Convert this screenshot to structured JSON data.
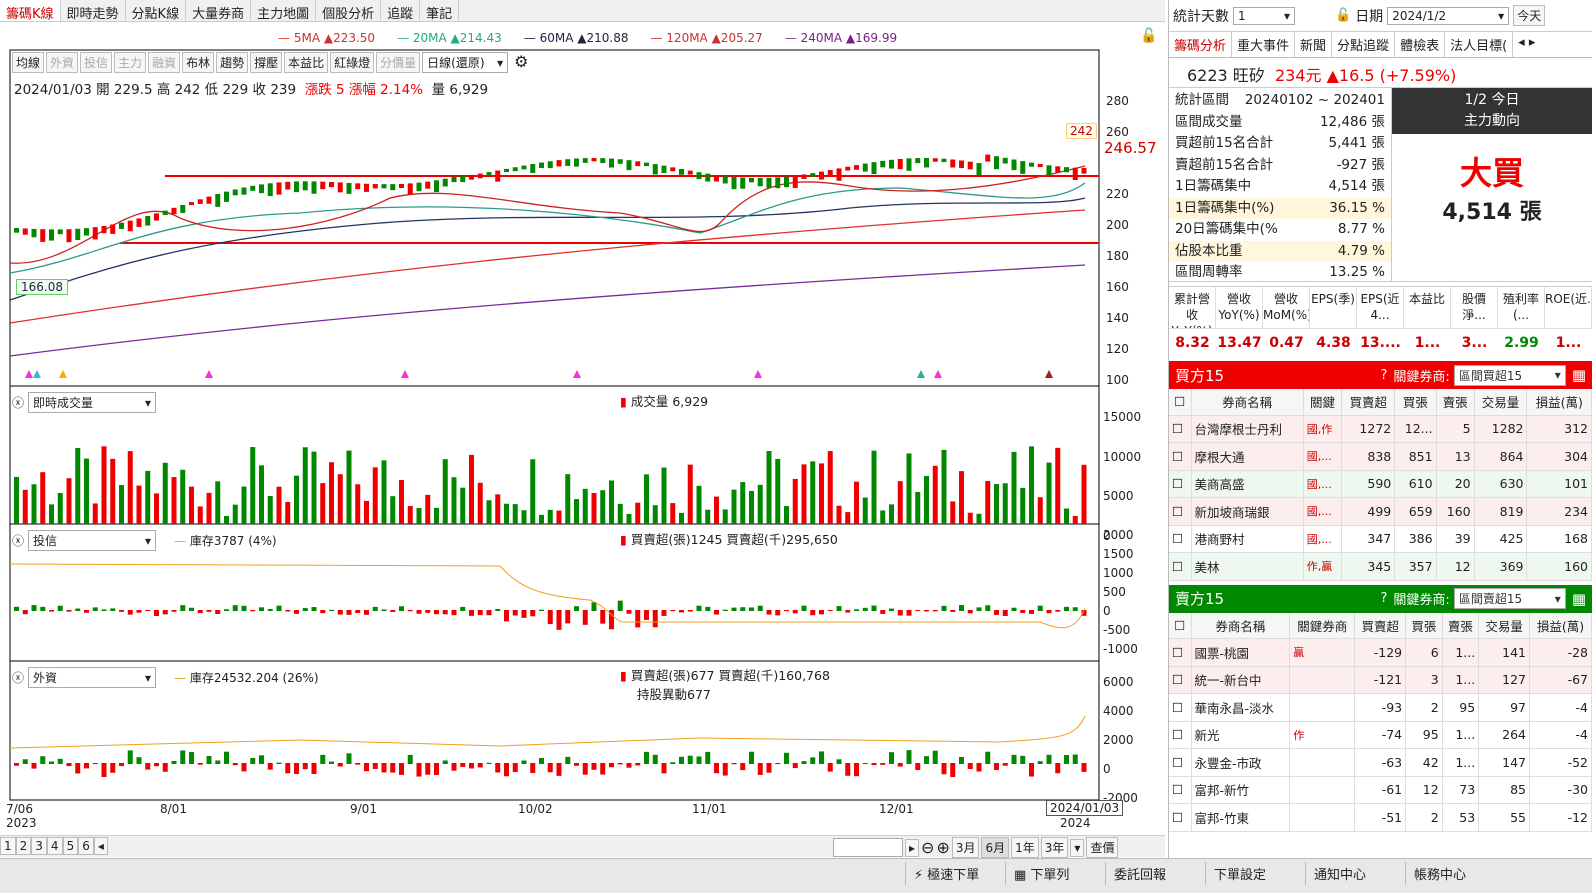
{
  "tabs": [
    "籌碼K線",
    "即時走勢",
    "分點K線",
    "大量券商",
    "主力地圖",
    "個股分析",
    "追蹤",
    "筆記"
  ],
  "ma": {
    "ma5": "5MA ▲223.50",
    "ma20": "20MA ▲214.43",
    "ma60": "60MA ▲210.88",
    "ma120": "120MA ▲205.27",
    "ma240": "240MA ▲169.99"
  },
  "toolbar": [
    "均線",
    "外資",
    "投信",
    "主力",
    "融資",
    "布林",
    "趨勢",
    "撐壓",
    "本益比",
    "紅綠燈",
    "分價量"
  ],
  "period": "日線(還原)",
  "ohlc": "2024/01/03 開 229.5 高 242 低 229 收 239",
  "change": "漲跌 5  漲幅 2.14%",
  "volume_label": "量 6,929",
  "price_axis": [
    "280",
    "260",
    "240",
    "220",
    "200",
    "180",
    "160",
    "140",
    "120",
    "100"
  ],
  "last_price": "246.57",
  "high_mark": "242",
  "low_mark": "166.08",
  "vol_panel": {
    "select": "即時成交量",
    "legend": "成交量  6,929",
    "axis": [
      "15000",
      "10000",
      "5000",
      "0"
    ]
  },
  "trust_panel": {
    "select": "投信",
    "inv": "庫存3787 (4%)",
    "legend": "買賣超(張)1245 買賣超(千)295,650",
    "axis": [
      "2000",
      "1500",
      "1000",
      "500",
      "0",
      "-500",
      "-1000"
    ]
  },
  "foreign_panel": {
    "select": "外資",
    "inv": "庫存24532.204 (26%)",
    "legend": "買賣超(張)677 買賣超(千)160,768",
    "legend2": "持股異動677",
    "axis": [
      "6000",
      "4000",
      "2000",
      "0",
      "-2000"
    ]
  },
  "xaxis": {
    "d0": "7/06",
    "y0": "2023",
    "d1": "8/01",
    "d2": "9/01",
    "d3": "10/02",
    "d4": "11/01",
    "d5": "12/01",
    "d6": "2024/01/03",
    "y1": "2024"
  },
  "bottom_pages": [
    "1",
    "2",
    "3",
    "4",
    "5",
    "6"
  ],
  "ranges": [
    "3月",
    "6月",
    "1年",
    "3年",
    "查價"
  ],
  "right": {
    "stat_days_label": "統計天數",
    "stat_days": "1",
    "date_label": "日期",
    "date": "2024/1/2",
    "today": "今天",
    "tabs": [
      "籌碼分析",
      "重大事件",
      "新聞",
      "分點追蹤",
      "體檢表",
      "法人目標("
    ],
    "stock": "6223 旺矽",
    "price": "234元",
    "chg": "▲16.5 (+7.59%)",
    "kv": [
      [
        "統計區間",
        "20240102 ~ 202401"
      ],
      [
        "區間成交量",
        "12,486 張"
      ],
      [
        "買超前15名合計",
        "5,441 張"
      ],
      [
        "賣超前15名合計",
        "-927 張"
      ],
      [
        "1日籌碼集中",
        "4,514 張"
      ],
      [
        "1日籌碼集中(%)",
        "36.15 %"
      ],
      [
        "20日籌碼集中(%",
        "8.77 %"
      ],
      [
        "佔股本比重",
        "4.79 %"
      ],
      [
        "區間周轉率",
        "13.25 %"
      ]
    ],
    "box_title1": "1/2 今日",
    "box_title2": "主力動向",
    "box_main": "大買",
    "box_sub": "4,514 張",
    "fin_heads": [
      "累計營收YoY(%)",
      "營收YoY(%)",
      "營收MoM(%)",
      "EPS(季)",
      "EPS(近4...",
      "本益比",
      "股價淨...",
      "殖利率(...",
      "ROE(近..."
    ],
    "fin_vals": [
      "8.32",
      "13.47",
      "0.47",
      "4.38",
      "13....",
      "1...",
      "3...",
      "2.99",
      "1..."
    ],
    "buy_title": "買方15",
    "key_broker": "關鍵券商:",
    "buy_sel": "區間買超15",
    "buy_heads": [
      "券商名稱",
      "關鍵",
      "買賣超",
      "買張",
      "賣張",
      "交易量",
      "損益(萬)"
    ],
    "buy_rows": [
      [
        "台灣摩根士丹利",
        "國,作",
        "1272",
        "12...",
        "5",
        "1282",
        "312"
      ],
      [
        "摩根大通",
        "國,...",
        "838",
        "851",
        "13",
        "864",
        "304"
      ],
      [
        "美商高盛",
        "國,...",
        "590",
        "610",
        "20",
        "630",
        "101"
      ],
      [
        "新加坡商瑞銀",
        "國,...",
        "499",
        "659",
        "160",
        "819",
        "234"
      ],
      [
        "港商野村",
        "國,...",
        "347",
        "386",
        "39",
        "425",
        "168"
      ],
      [
        "美林",
        "作,贏",
        "345",
        "357",
        "12",
        "369",
        "160"
      ]
    ],
    "sell_title": "賣方15",
    "sell_sel": "區間賣超15",
    "sell_heads": [
      "券商名稱",
      "關鍵券商",
      "買賣超",
      "買張",
      "賣張",
      "交易量",
      "損益(萬)"
    ],
    "sell_rows": [
      [
        "國票-桃園",
        "贏",
        "-129",
        "6",
        "1...",
        "141",
        "-28"
      ],
      [
        "統一-新台中",
        "",
        "-121",
        "3",
        "1...",
        "127",
        "-67"
      ],
      [
        "華南永昌-淡水",
        "",
        "-93",
        "2",
        "95",
        "97",
        "-4"
      ],
      [
        "新光",
        "作",
        "-74",
        "95",
        "1...",
        "264",
        "-4"
      ],
      [
        "永豐金-市政",
        "",
        "-63",
        "42",
        "1...",
        "147",
        "-52"
      ],
      [
        "富邦-新竹",
        "",
        "-61",
        "12",
        "73",
        "85",
        "-30"
      ],
      [
        "富邦-竹東",
        "",
        "-51",
        "2",
        "53",
        "55",
        "-12"
      ]
    ]
  },
  "status": [
    "極速下單",
    "下單列",
    "委託回報",
    "下單設定",
    "通知中心",
    "帳務中心"
  ]
}
